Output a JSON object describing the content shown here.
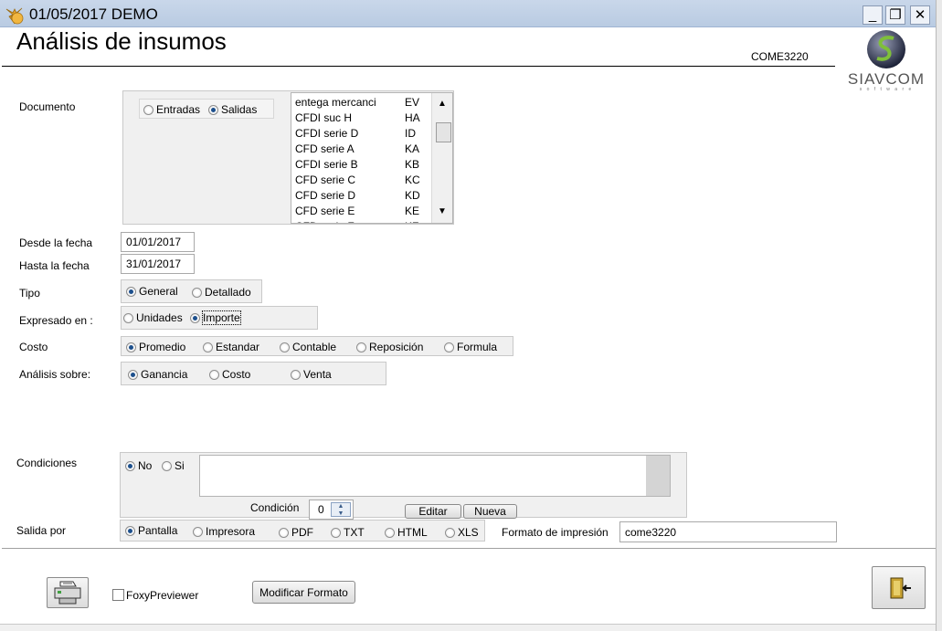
{
  "window": {
    "title": "01/05/2017  DEMO",
    "minimize": "_",
    "restore": "❐",
    "close": "✕"
  },
  "header": {
    "title": "Análisis de insumos",
    "form_code": "COME3220",
    "logo_text": "SIAVCOM",
    "logo_sub": "s o f t w a r e"
  },
  "documento": {
    "label": "Documento",
    "options": [
      "Entradas",
      "Salidas"
    ],
    "selected": "Salidas",
    "list": [
      {
        "name": "entega mercanci",
        "code": "EV"
      },
      {
        "name": "CFDI  suc  H",
        "code": "HA"
      },
      {
        "name": "CFDI  serie D",
        "code": "ID"
      },
      {
        "name": "CFD serie A",
        "code": "KA"
      },
      {
        "name": "CFDI serie B",
        "code": "KB"
      },
      {
        "name": "CFD serie C",
        "code": "KC"
      },
      {
        "name": "CFD serie D",
        "code": "KD"
      },
      {
        "name": "CFD serie E",
        "code": "KE"
      },
      {
        "name": "CFD serie F",
        "code": "KF"
      }
    ]
  },
  "fechas": {
    "desde_label": "Desde la fecha",
    "desde_value": "01/01/2017",
    "hasta_label": "Hasta la fecha",
    "hasta_value": "31/01/2017"
  },
  "tipo": {
    "label": "Tipo",
    "options": [
      "General",
      "Detallado"
    ],
    "selected": "General"
  },
  "expresado": {
    "label": "Expresado en :",
    "options": [
      "Unidades",
      "Importe"
    ],
    "selected": "Importe"
  },
  "costo": {
    "label": "Costo",
    "options": [
      "Promedio",
      "Estandar",
      "Contable",
      "Reposición",
      "Formula"
    ],
    "selected": "Promedio"
  },
  "analisis": {
    "label": "Análisis sobre:",
    "options": [
      "Ganancia",
      "Costo",
      "Venta"
    ],
    "selected": "Ganancia"
  },
  "condiciones": {
    "label": "Condiciones",
    "options": [
      "No",
      "Si"
    ],
    "selected": "No",
    "text": "",
    "condicion_label": "Condición",
    "condicion_value": "0",
    "editar": "Editar",
    "nueva": "Nueva"
  },
  "salida": {
    "label": "Salida por",
    "options": [
      "Pantalla",
      "Impresora",
      "PDF",
      "TXT",
      "HTML",
      "XLS"
    ],
    "selected": "Pantalla",
    "formato_label": "Formato de impresión",
    "formato_value": "come3220"
  },
  "footer": {
    "foxy_label": "FoxyPreviewer",
    "foxy_checked": false,
    "modificar": "Modificar Formato"
  }
}
